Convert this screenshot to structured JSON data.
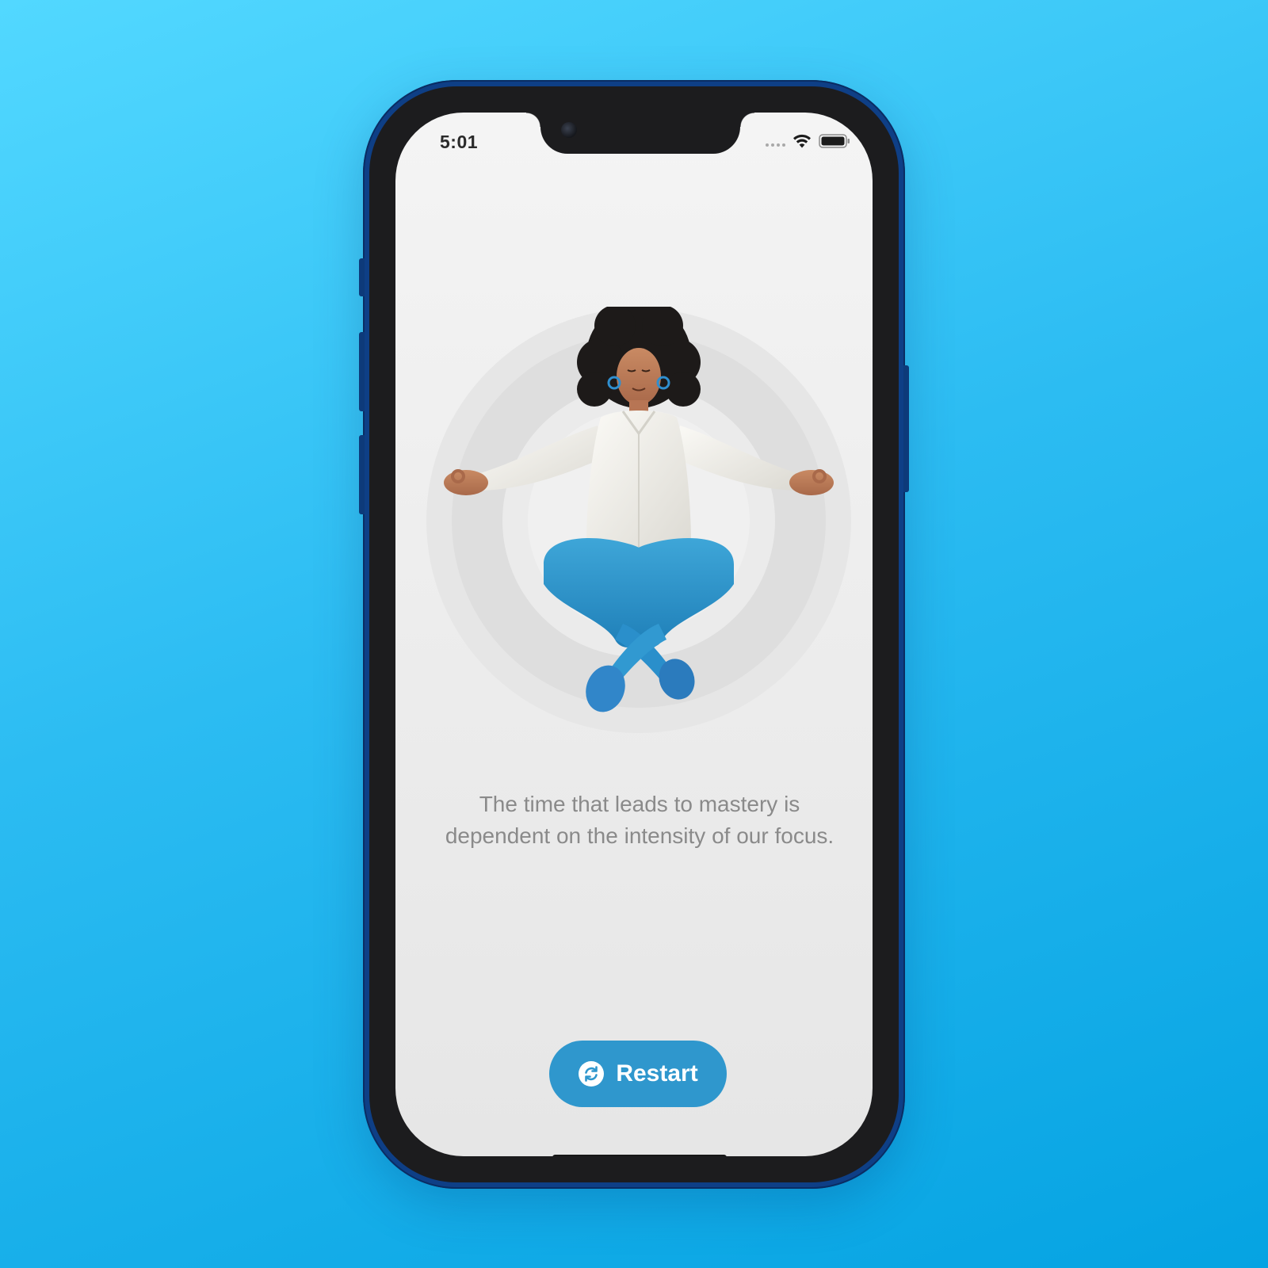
{
  "status_bar": {
    "time": "5:01"
  },
  "content": {
    "quote": "The time that leads to mastery is dependent on the intensity of our focus."
  },
  "actions": {
    "restart_label": "Restart"
  },
  "icons": {
    "restart": "restart-icon",
    "wifi": "wifi-icon",
    "battery": "battery-icon",
    "signal": "signal-icon"
  },
  "colors": {
    "background_top": "#52d8ff",
    "background_bottom": "#05a3e2",
    "phone_frame": "#0e3f86",
    "screen": "#efefef",
    "button": "#2f97cd",
    "button_text": "#ffffff",
    "quote_text": "#8a8a8a"
  }
}
